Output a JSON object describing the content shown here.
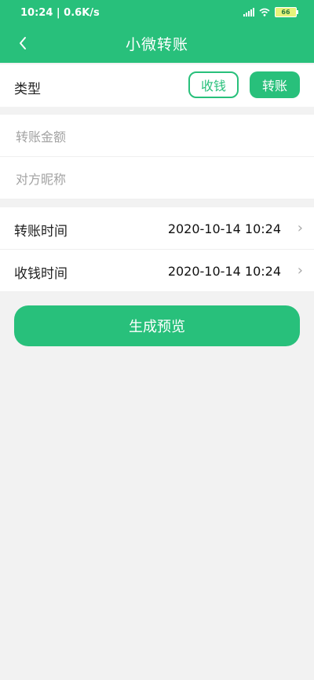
{
  "status": {
    "time": "10:24 | 0.6K/s",
    "battery": "66"
  },
  "header": {
    "back_icon": "chevron-left-icon",
    "title": "小微转账"
  },
  "type": {
    "label": "类型",
    "options": [
      "收钱",
      "转账"
    ],
    "selected": "转账"
  },
  "inputs": {
    "amount_placeholder": "转账金额",
    "nickname_placeholder": "对方昵称"
  },
  "times": [
    {
      "label": "转账时间",
      "value": "2020-10-14 10:24"
    },
    {
      "label": "收钱时间",
      "value": "2020-10-14 10:24"
    }
  ],
  "cta": {
    "label": "生成预览"
  },
  "colors": {
    "accent": "#28c07b",
    "background": "#f2f2f2"
  }
}
